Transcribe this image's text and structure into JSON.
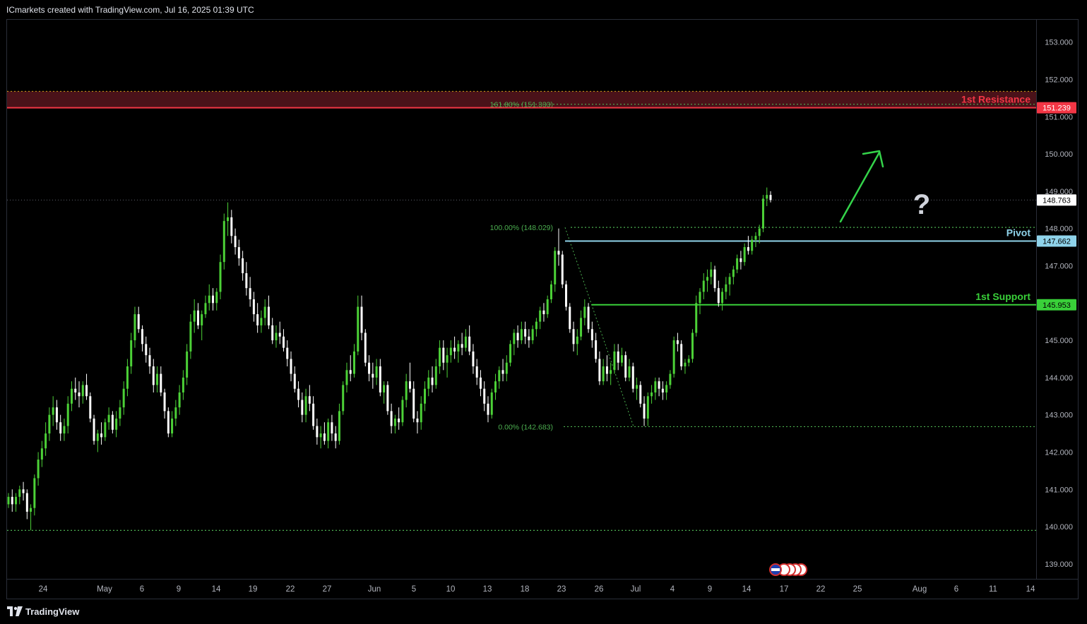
{
  "header": {
    "text": "ICmarkets created with TradingView.com, Jul 16, 2025 01:39 UTC"
  },
  "footer": {
    "brand": "TradingView"
  },
  "colors": {
    "bg": "#000000",
    "up": "#4cd137",
    "down": "#ffffff",
    "resistance": "#f23645",
    "pivot": "#8fd3ea",
    "support": "#39d039",
    "fib": "#4caf50",
    "arrow": "#34d34a"
  },
  "chart_data": {
    "type": "candlestick",
    "symbol_note": "",
    "ylim": [
      138.6,
      153.6
    ],
    "y_ticks": [
      "153.000",
      "152.000",
      "151.000",
      "150.000",
      "149.000",
      "148.000",
      "147.000",
      "146.000",
      "145.000",
      "144.000",
      "143.000",
      "142.000",
      "141.000",
      "140.000",
      "139.000"
    ],
    "x_ticks": [
      "24",
      "May",
      "6",
      "9",
      "14",
      "19",
      "22",
      "27",
      "Jun",
      "5",
      "10",
      "13",
      "18",
      "23",
      "26",
      "Jul",
      "4",
      "9",
      "14",
      "17",
      "22",
      "25",
      "Aug",
      "6",
      "11",
      "14"
    ],
    "levels": [
      {
        "label": "1st Resistance",
        "value": 151.239,
        "tag": "151.239",
        "color": "#f23645"
      },
      {
        "label": "Pivot",
        "value": 147.662,
        "tag": "147.662",
        "color": "#8fd3ea"
      },
      {
        "label": "1st Support",
        "value": 145.953,
        "tag": "145.953",
        "color": "#39d039"
      }
    ],
    "current_price": {
      "value": 148.763,
      "tag": "148.763"
    },
    "fib_levels": [
      {
        "label": "161.80% (151.333)",
        "value": 151.333
      },
      {
        "label": "100.00% (148.029)",
        "value": 148.029
      },
      {
        "label": "0.00% (142.683)",
        "value": 142.683
      }
    ],
    "extra_level": 139.9,
    "resistance_zone": [
      151.239,
      151.68
    ],
    "annotation": "?",
    "candles": [
      [
        140.6,
        140.9,
        140.5,
        140.8
      ],
      [
        140.8,
        141.0,
        140.4,
        140.6
      ],
      [
        140.6,
        140.9,
        140.4,
        140.8
      ],
      [
        140.8,
        141.1,
        140.6,
        141.0
      ],
      [
        141.0,
        141.2,
        140.7,
        140.9
      ],
      [
        140.9,
        141.0,
        140.2,
        140.4
      ],
      [
        140.4,
        140.6,
        139.9,
        140.5
      ],
      [
        140.5,
        141.4,
        140.3,
        141.3
      ],
      [
        141.3,
        142.0,
        141.1,
        141.8
      ],
      [
        141.8,
        142.3,
        141.6,
        142.1
      ],
      [
        142.1,
        142.8,
        141.9,
        142.5
      ],
      [
        142.5,
        143.2,
        142.3,
        143.0
      ],
      [
        143.0,
        143.5,
        142.7,
        143.2
      ],
      [
        143.2,
        143.4,
        142.6,
        142.8
      ],
      [
        142.8,
        143.0,
        142.3,
        142.5
      ],
      [
        142.5,
        142.9,
        142.3,
        142.7
      ],
      [
        142.7,
        143.5,
        142.5,
        143.3
      ],
      [
        143.3,
        143.9,
        143.1,
        143.7
      ],
      [
        143.7,
        144.0,
        143.4,
        143.6
      ],
      [
        143.6,
        143.9,
        143.2,
        143.5
      ],
      [
        143.5,
        143.9,
        143.3,
        143.8
      ],
      [
        143.8,
        144.1,
        143.4,
        143.5
      ],
      [
        143.5,
        143.6,
        142.8,
        142.9
      ],
      [
        142.9,
        143.0,
        142.2,
        142.3
      ],
      [
        142.3,
        142.6,
        142.0,
        142.5
      ],
      [
        142.5,
        142.8,
        142.2,
        142.4
      ],
      [
        142.4,
        142.9,
        142.3,
        142.8
      ],
      [
        142.8,
        143.2,
        142.6,
        143.0
      ],
      [
        143.0,
        143.1,
        142.5,
        142.6
      ],
      [
        142.6,
        143.1,
        142.4,
        142.9
      ],
      [
        142.9,
        143.4,
        142.7,
        143.2
      ],
      [
        143.2,
        143.9,
        143.0,
        143.7
      ],
      [
        143.7,
        144.5,
        143.5,
        144.3
      ],
      [
        144.3,
        145.2,
        144.1,
        145.0
      ],
      [
        145.0,
        145.9,
        144.8,
        145.7
      ],
      [
        145.7,
        145.9,
        145.2,
        145.3
      ],
      [
        145.3,
        145.4,
        144.7,
        144.9
      ],
      [
        144.9,
        145.1,
        144.4,
        144.6
      ],
      [
        144.6,
        144.8,
        144.1,
        144.3
      ],
      [
        144.3,
        144.5,
        143.6,
        143.8
      ],
      [
        143.8,
        144.3,
        143.6,
        144.1
      ],
      [
        144.1,
        144.3,
        143.5,
        143.6
      ],
      [
        143.6,
        143.7,
        142.9,
        143.1
      ],
      [
        143.1,
        143.2,
        142.4,
        142.5
      ],
      [
        142.5,
        143.1,
        142.4,
        142.9
      ],
      [
        142.9,
        143.4,
        142.7,
        143.2
      ],
      [
        143.2,
        143.8,
        143.0,
        143.6
      ],
      [
        143.6,
        144.2,
        143.4,
        144.0
      ],
      [
        144.0,
        144.9,
        143.8,
        144.7
      ],
      [
        144.7,
        145.7,
        144.5,
        145.5
      ],
      [
        145.5,
        146.1,
        145.2,
        145.8
      ],
      [
        145.8,
        146.0,
        145.3,
        145.4
      ],
      [
        145.4,
        145.8,
        145.0,
        145.7
      ],
      [
        145.7,
        146.2,
        145.6,
        146.0
      ],
      [
        146.0,
        146.5,
        145.8,
        146.2
      ],
      [
        146.2,
        146.4,
        145.8,
        146.0
      ],
      [
        146.0,
        146.4,
        145.8,
        146.3
      ],
      [
        146.3,
        147.3,
        146.1,
        147.1
      ],
      [
        147.1,
        148.4,
        146.9,
        148.2
      ],
      [
        148.2,
        148.7,
        147.8,
        148.3
      ],
      [
        148.3,
        148.5,
        147.6,
        147.8
      ],
      [
        147.8,
        148.0,
        147.3,
        147.5
      ],
      [
        147.5,
        147.7,
        147.0,
        147.2
      ],
      [
        147.2,
        147.4,
        146.6,
        146.8
      ],
      [
        146.8,
        147.1,
        146.2,
        146.4
      ],
      [
        146.4,
        146.7,
        145.9,
        146.1
      ],
      [
        146.1,
        146.3,
        145.5,
        145.7
      ],
      [
        145.7,
        146.0,
        145.2,
        145.4
      ],
      [
        145.4,
        145.8,
        145.2,
        145.6
      ],
      [
        145.6,
        146.1,
        145.4,
        145.9
      ],
      [
        145.9,
        146.2,
        145.3,
        145.4
      ],
      [
        145.4,
        145.6,
        144.9,
        145.0
      ],
      [
        145.0,
        145.4,
        144.8,
        145.2
      ],
      [
        145.2,
        145.5,
        144.9,
        145.1
      ],
      [
        145.1,
        145.3,
        144.7,
        144.8
      ],
      [
        144.8,
        145.0,
        144.3,
        144.5
      ],
      [
        144.5,
        144.7,
        143.9,
        144.1
      ],
      [
        144.1,
        144.3,
        143.6,
        143.7
      ],
      [
        143.7,
        143.9,
        143.2,
        143.4
      ],
      [
        143.4,
        143.6,
        142.8,
        143.0
      ],
      [
        143.0,
        143.7,
        142.8,
        143.5
      ],
      [
        143.5,
        143.8,
        143.1,
        143.3
      ],
      [
        143.3,
        143.5,
        142.6,
        142.7
      ],
      [
        142.7,
        142.9,
        142.2,
        142.4
      ],
      [
        142.4,
        142.7,
        142.1,
        142.5
      ],
      [
        142.5,
        142.8,
        142.2,
        142.3
      ],
      [
        142.3,
        142.9,
        142.1,
        142.8
      ],
      [
        142.8,
        143.0,
        142.3,
        142.5
      ],
      [
        142.5,
        142.7,
        142.1,
        142.3
      ],
      [
        142.3,
        143.3,
        142.2,
        143.1
      ],
      [
        143.1,
        143.9,
        143.0,
        143.8
      ],
      [
        143.8,
        144.4,
        143.6,
        144.2
      ],
      [
        144.2,
        144.6,
        143.9,
        144.1
      ],
      [
        144.1,
        144.9,
        144.0,
        144.7
      ],
      [
        144.7,
        146.2,
        144.6,
        145.9
      ],
      [
        145.9,
        146.2,
        145.0,
        145.2
      ],
      [
        145.2,
        145.3,
        144.3,
        144.4
      ],
      [
        144.4,
        144.6,
        143.9,
        144.1
      ],
      [
        144.1,
        144.4,
        143.7,
        144.0
      ],
      [
        144.0,
        144.5,
        143.8,
        144.3
      ],
      [
        144.3,
        144.5,
        143.5,
        143.6
      ],
      [
        143.6,
        143.9,
        143.3,
        143.8
      ],
      [
        143.8,
        143.9,
        143.0,
        143.1
      ],
      [
        143.1,
        143.3,
        142.5,
        142.7
      ],
      [
        142.7,
        143.0,
        142.5,
        142.9
      ],
      [
        142.9,
        143.2,
        142.6,
        142.8
      ],
      [
        142.8,
        143.5,
        142.7,
        143.4
      ],
      [
        143.4,
        144.1,
        143.2,
        143.9
      ],
      [
        143.9,
        144.4,
        143.6,
        143.7
      ],
      [
        143.7,
        143.9,
        142.8,
        142.9
      ],
      [
        142.9,
        143.1,
        142.5,
        142.8
      ],
      [
        142.8,
        143.5,
        142.6,
        143.3
      ],
      [
        143.3,
        143.9,
        143.1,
        143.7
      ],
      [
        143.7,
        144.2,
        143.5,
        144.0
      ],
      [
        144.0,
        144.3,
        143.6,
        143.8
      ],
      [
        143.8,
        144.5,
        143.7,
        144.3
      ],
      [
        144.3,
        145.0,
        144.1,
        144.8
      ],
      [
        144.8,
        145.0,
        144.2,
        144.4
      ],
      [
        144.4,
        144.8,
        144.0,
        144.6
      ],
      [
        144.6,
        145.0,
        144.4,
        144.8
      ],
      [
        144.8,
        145.1,
        144.5,
        144.7
      ],
      [
        144.7,
        145.0,
        144.4,
        144.9
      ],
      [
        144.9,
        145.2,
        144.6,
        144.8
      ],
      [
        144.8,
        145.3,
        144.7,
        145.1
      ],
      [
        145.1,
        145.4,
        144.6,
        144.7
      ],
      [
        144.7,
        144.9,
        144.1,
        144.3
      ],
      [
        144.3,
        144.5,
        143.8,
        144.0
      ],
      [
        144.0,
        144.2,
        143.5,
        143.7
      ],
      [
        143.7,
        143.9,
        143.1,
        143.3
      ],
      [
        143.3,
        143.5,
        142.8,
        143.0
      ],
      [
        143.0,
        143.7,
        142.9,
        143.6
      ],
      [
        143.6,
        144.1,
        143.4,
        143.9
      ],
      [
        143.9,
        144.3,
        143.7,
        144.2
      ],
      [
        144.2,
        144.5,
        143.9,
        144.1
      ],
      [
        144.1,
        144.6,
        143.9,
        144.4
      ],
      [
        144.4,
        145.0,
        144.3,
        144.9
      ],
      [
        144.9,
        145.3,
        144.6,
        145.2
      ],
      [
        145.2,
        145.4,
        144.8,
        145.0
      ],
      [
        145.0,
        145.5,
        144.9,
        145.3
      ],
      [
        145.3,
        145.5,
        144.9,
        145.1
      ],
      [
        145.1,
        145.3,
        144.8,
        145.0
      ],
      [
        145.0,
        145.4,
        144.9,
        145.3
      ],
      [
        145.3,
        145.6,
        145.1,
        145.5
      ],
      [
        145.5,
        145.9,
        145.3,
        145.8
      ],
      [
        145.8,
        146.0,
        145.5,
        145.7
      ],
      [
        145.7,
        146.2,
        145.6,
        146.1
      ],
      [
        146.1,
        146.6,
        146.0,
        146.5
      ],
      [
        146.5,
        147.5,
        146.3,
        147.4
      ],
      [
        147.4,
        148.0,
        147.0,
        147.3
      ],
      [
        147.3,
        147.4,
        146.4,
        146.5
      ],
      [
        146.5,
        146.6,
        145.8,
        145.9
      ],
      [
        145.9,
        146.0,
        145.2,
        145.3
      ],
      [
        145.3,
        145.5,
        144.7,
        144.9
      ],
      [
        144.9,
        145.3,
        144.6,
        145.1
      ],
      [
        145.1,
        145.8,
        145.0,
        145.6
      ],
      [
        145.6,
        146.1,
        145.4,
        145.9
      ],
      [
        145.9,
        146.0,
        145.2,
        145.3
      ],
      [
        145.3,
        145.5,
        144.8,
        145.0
      ],
      [
        145.0,
        145.2,
        144.4,
        144.5
      ],
      [
        144.5,
        144.7,
        143.8,
        143.9
      ],
      [
        143.9,
        144.5,
        143.8,
        144.3
      ],
      [
        144.3,
        144.6,
        143.9,
        144.1
      ],
      [
        144.1,
        144.4,
        143.8,
        144.2
      ],
      [
        144.2,
        144.9,
        144.1,
        144.7
      ],
      [
        144.7,
        144.9,
        144.2,
        144.4
      ],
      [
        144.4,
        144.8,
        144.3,
        144.6
      ],
      [
        144.6,
        144.7,
        143.9,
        144.0
      ],
      [
        144.0,
        144.5,
        143.9,
        144.3
      ],
      [
        144.3,
        144.4,
        143.6,
        143.7
      ],
      [
        143.7,
        144.0,
        143.4,
        143.8
      ],
      [
        143.8,
        143.9,
        143.2,
        143.3
      ],
      [
        143.3,
        143.5,
        142.7,
        142.9
      ],
      [
        142.9,
        143.6,
        142.7,
        143.5
      ],
      [
        143.5,
        143.8,
        143.3,
        143.6
      ],
      [
        143.6,
        144.0,
        143.4,
        143.9
      ],
      [
        143.9,
        144.0,
        143.5,
        143.7
      ],
      [
        143.7,
        143.9,
        143.4,
        143.6
      ],
      [
        143.6,
        143.9,
        143.4,
        143.8
      ],
      [
        143.8,
        144.2,
        143.7,
        144.1
      ],
      [
        144.1,
        145.1,
        144.0,
        145.0
      ],
      [
        145.0,
        145.2,
        144.7,
        144.9
      ],
      [
        144.9,
        145.0,
        144.2,
        144.3
      ],
      [
        144.3,
        144.5,
        144.1,
        144.4
      ],
      [
        144.4,
        144.6,
        144.3,
        144.5
      ],
      [
        144.5,
        145.3,
        144.4,
        145.2
      ],
      [
        145.2,
        146.2,
        145.1,
        146.0
      ],
      [
        146.0,
        146.4,
        145.7,
        146.3
      ],
      [
        146.3,
        146.8,
        146.1,
        146.6
      ],
      [
        146.6,
        146.9,
        146.3,
        146.7
      ],
      [
        146.7,
        147.1,
        146.5,
        146.9
      ],
      [
        146.9,
        147.0,
        146.3,
        146.4
      ],
      [
        146.4,
        146.6,
        145.9,
        146.0
      ],
      [
        146.0,
        146.4,
        145.8,
        146.3
      ],
      [
        146.3,
        146.7,
        146.1,
        146.5
      ],
      [
        146.5,
        146.8,
        146.2,
        146.7
      ],
      [
        146.7,
        147.0,
        146.5,
        146.9
      ],
      [
        146.9,
        147.3,
        146.8,
        147.2
      ],
      [
        147.2,
        147.4,
        146.9,
        147.1
      ],
      [
        147.1,
        147.6,
        147.0,
        147.5
      ],
      [
        147.5,
        147.8,
        147.3,
        147.4
      ],
      [
        147.4,
        147.8,
        147.3,
        147.7
      ],
      [
        147.7,
        147.9,
        147.5,
        147.8
      ],
      [
        147.8,
        148.1,
        147.6,
        148.0
      ],
      [
        148.0,
        148.9,
        147.9,
        148.8
      ],
      [
        148.8,
        149.1,
        148.6,
        148.9
      ],
      [
        148.9,
        149.0,
        148.7,
        148.763
      ]
    ]
  }
}
